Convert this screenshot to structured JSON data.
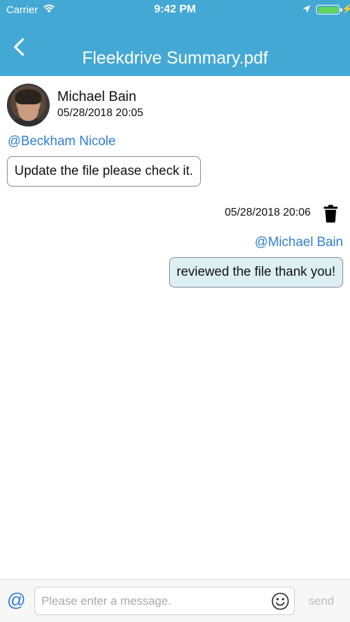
{
  "status_bar": {
    "carrier": "Carrier",
    "time": "9:42 PM",
    "battery_color": "#5fd55b"
  },
  "nav": {
    "title": "Fleekdrive Summary.pdf",
    "back_icon": "chevron-left-icon",
    "header_color": "#44a8d4"
  },
  "messages": [
    {
      "sender": "Michael Bain",
      "timestamp": "05/28/2018 20:05",
      "mention": "@Beckham Nicole",
      "text": "Update the file please check it."
    },
    {
      "timestamp": "05/28/2018 20:06",
      "mention": "@Michael Bain",
      "text": "reviewed the file thank you!",
      "bubble_color": "#dcf0f4"
    }
  ],
  "composer": {
    "mention_button": "@",
    "placeholder": "Please enter a message.",
    "send_label": "send",
    "emoji_icon": "smiley-icon"
  },
  "colors": {
    "mention": "#2f7fd6"
  }
}
